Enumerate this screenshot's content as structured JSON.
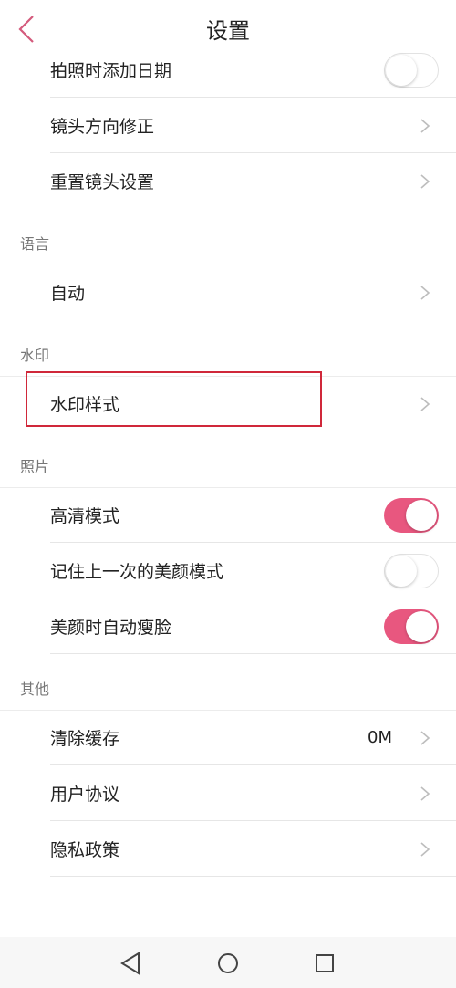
{
  "header": {
    "title": "设置"
  },
  "groups": {
    "camera": {
      "items": [
        {
          "label": "拍照时添加日期",
          "type": "switch",
          "on": false
        },
        {
          "label": "镜头方向修正",
          "type": "chevron"
        },
        {
          "label": "重置镜头设置",
          "type": "chevron"
        }
      ]
    },
    "language": {
      "title": "语言",
      "items": [
        {
          "label": "自动",
          "type": "chevron"
        }
      ]
    },
    "watermark": {
      "title": "水印",
      "items": [
        {
          "label": "水印样式",
          "type": "chevron"
        }
      ]
    },
    "photo": {
      "title": "照片",
      "items": [
        {
          "label": "高清模式",
          "type": "switch",
          "on": true
        },
        {
          "label": "记住上一次的美颜模式",
          "type": "switch",
          "on": false
        },
        {
          "label": "美颜时自动瘦脸",
          "type": "switch",
          "on": true
        }
      ]
    },
    "other": {
      "title": "其他",
      "items": [
        {
          "label": "清除缓存",
          "type": "chevron",
          "value": "0M"
        },
        {
          "label": "用户协议",
          "type": "chevron"
        },
        {
          "label": "隐私政策",
          "type": "chevron"
        }
      ]
    }
  },
  "colors": {
    "accent": "#e8577f",
    "highlight": "#d0283a",
    "back_arrow": "#d45a7c"
  },
  "icons": {
    "back": "chevron-left-icon",
    "row_arrow": "chevron-right-icon",
    "nav": [
      "nav-back-icon",
      "nav-home-icon",
      "nav-recents-icon"
    ]
  }
}
